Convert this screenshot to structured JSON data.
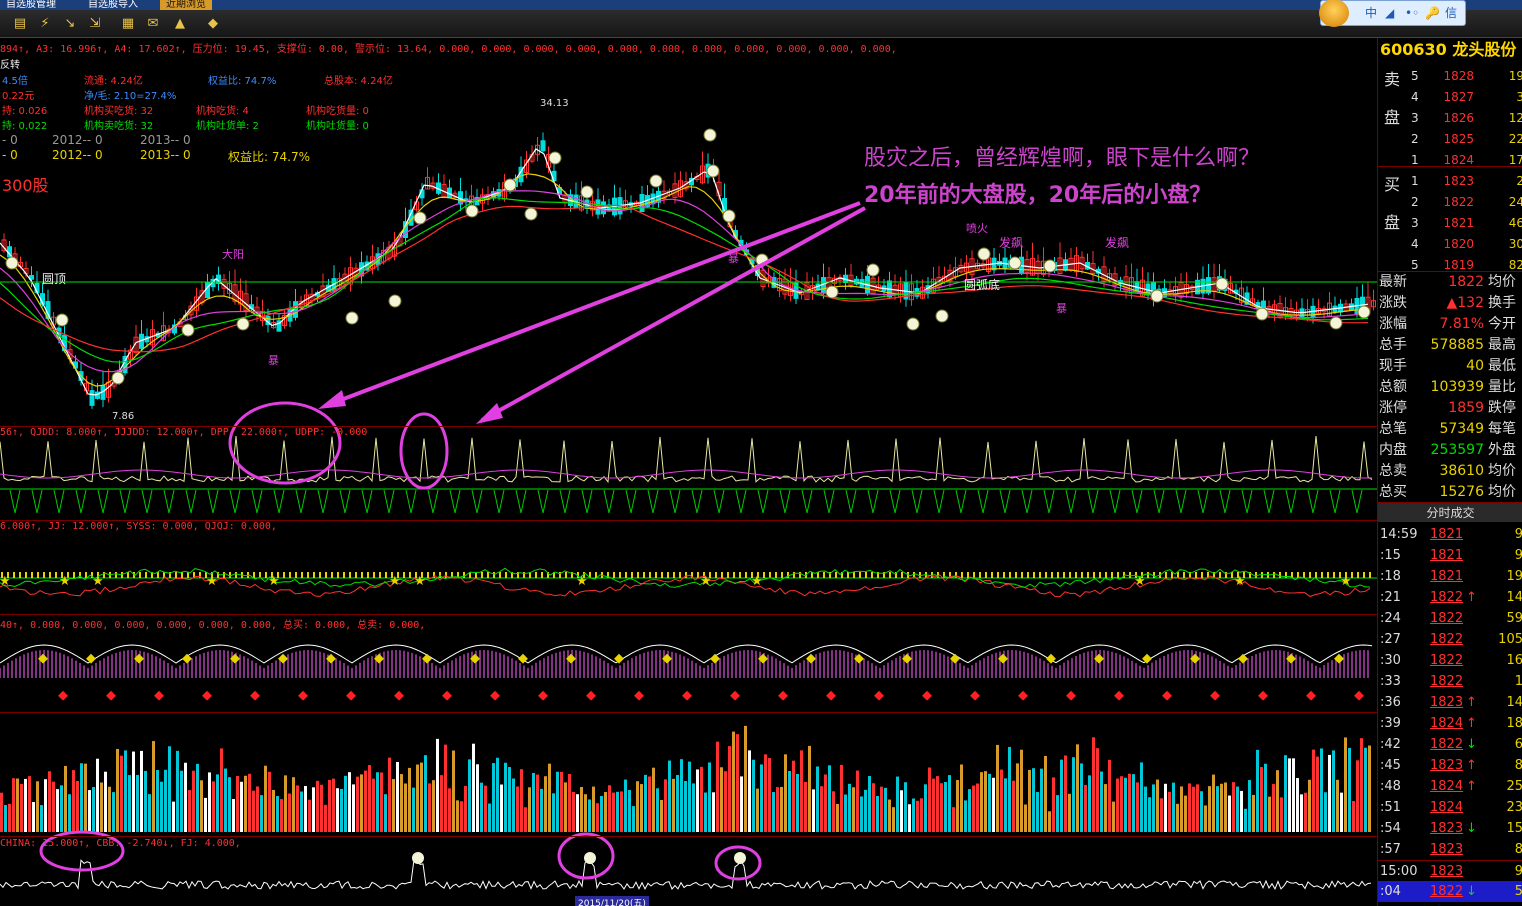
{
  "tabs": [
    "自选股管理",
    "自选股导入",
    "近期浏览"
  ],
  "qq_bar": [
    "中",
    "◢",
    "•◦",
    "🔑",
    "信"
  ],
  "indicator_lines": {
    "main": "894↑, A3: 16.996↑, A4: 17.602↑, 压力位: 19.45, 支撑位: 0.00, 警示位: 13.64, 0.000, 0.000, 0.000, 0.000, 0.000, 0.000, 0.000, 0.000, 0.000, 0.000, 0.000,",
    "fundamentals": [
      [
        "反转"
      ],
      [
        "4.5倍",
        "流通: 4.24亿",
        "权益比: 74.7%",
        "总股本: 4.24亿"
      ],
      [
        "0.22元",
        "净/毛: 2.10=27.4%"
      ],
      [
        "持: 0.026",
        "机构买吃货: 32",
        "机构吃货: 4",
        "机构吃货量: 0"
      ],
      [
        "持: 0.022",
        "机构卖吃货: 32",
        "机构吐货单: 2",
        "机构吐货量: 0"
      ],
      [
        "- 0",
        "2012-- 0",
        "2013-- 0"
      ],
      [
        "- 0",
        "2012-- 0",
        "2013-- 0",
        "权益比: 74.7%"
      ],
      [
        "300股"
      ]
    ],
    "sub1": "56↑, QJDD: 8.000↑, JJJDD: 12.000↑, DPP: 22.000↑, UDPP: -0.000",
    "sub2": "6.000↑, JJ: 12.000↑, SYSS: 0.000, QJQJ: 0.000,",
    "sub3": "40↑, 0.000, 0.000, 0.000, 0.000, 0.000, 0.000, 总买: 0.000, 总卖: 0.000,",
    "sub5": "CHINA: 15.000↑, CBB: -2.740↓, FJ: 4.000,"
  },
  "chart_labels": {
    "price_high": "34.13",
    "price_low": "7.86",
    "signals": [
      "圆顶",
      "圆弧底",
      "发飙",
      "发飙",
      "暴",
      "暴",
      "暴",
      "喷火",
      "大阳"
    ],
    "bottom_date": "2015/11/20(五)"
  },
  "annotation": {
    "line1": "股灾之后，曾经辉煌啊，眼下是什么啊？",
    "line2": "20年前的大盘股，20年后的小盘？"
  },
  "quote_panel": {
    "code": "600630",
    "name": "龙头股份",
    "sell_label": [
      "卖",
      "盘"
    ],
    "buy_label": [
      "买",
      "盘"
    ],
    "asks": [
      {
        "lv": "5",
        "price": "1828",
        "vol": "19"
      },
      {
        "lv": "4",
        "price": "1827",
        "vol": "3"
      },
      {
        "lv": "3",
        "price": "1826",
        "vol": "12"
      },
      {
        "lv": "2",
        "price": "1825",
        "vol": "22"
      },
      {
        "lv": "1",
        "price": "1824",
        "vol": "17"
      }
    ],
    "bids": [
      {
        "lv": "1",
        "price": "1823",
        "vol": "2"
      },
      {
        "lv": "2",
        "price": "1822",
        "vol": "24"
      },
      {
        "lv": "3",
        "price": "1821",
        "vol": "46"
      },
      {
        "lv": "4",
        "price": "1820",
        "vol": "30"
      },
      {
        "lv": "5",
        "price": "1819",
        "vol": "82"
      }
    ],
    "stats": [
      {
        "k": "最新",
        "v": "1822",
        "k2": "均价",
        "c": "red"
      },
      {
        "k": "涨跌",
        "v": "▲132",
        "k2": "换手",
        "c": "red"
      },
      {
        "k": "涨幅",
        "v": "7.81%",
        "k2": "今开",
        "c": "red"
      },
      {
        "k": "总手",
        "v": "578885",
        "k2": "最高",
        "c": "yel"
      },
      {
        "k": "现手",
        "v": "40",
        "k2": "最低",
        "c": "yel"
      },
      {
        "k": "总额",
        "v": "103939",
        "k2": "量比",
        "c": "yel"
      },
      {
        "k": "涨停",
        "v": "1859",
        "k2": "跌停",
        "c": "red"
      },
      {
        "k": "总笔",
        "v": "57349",
        "k2": "每笔",
        "c": "yel"
      },
      {
        "k": "内盘",
        "v": "253597",
        "k2": "外盘",
        "c": "grn"
      },
      {
        "k": "总卖",
        "v": "38610",
        "k2": "均价",
        "c": "yel"
      },
      {
        "k": "总买",
        "v": "15276",
        "k2": "均价",
        "c": "yel"
      }
    ],
    "ticks_title": "分时成交",
    "ticks": [
      {
        "t": "14:59",
        "p": "1821",
        "a": "",
        "v": "9"
      },
      {
        "t": ":15",
        "p": "1821",
        "a": "",
        "v": "9"
      },
      {
        "t": ":18",
        "p": "1821",
        "a": "",
        "v": "19"
      },
      {
        "t": ":21",
        "p": "1822",
        "a": "↑",
        "v": "14"
      },
      {
        "t": ":24",
        "p": "1822",
        "a": "",
        "v": "59"
      },
      {
        "t": ":27",
        "p": "1822",
        "a": "",
        "v": "105"
      },
      {
        "t": ":30",
        "p": "1822",
        "a": "",
        "v": "16"
      },
      {
        "t": ":33",
        "p": "1822",
        "a": "",
        "v": "1"
      },
      {
        "t": ":36",
        "p": "1823",
        "a": "↑",
        "v": "14"
      },
      {
        "t": ":39",
        "p": "1824",
        "a": "↑",
        "v": "18"
      },
      {
        "t": ":42",
        "p": "1822",
        "a": "↓",
        "v": "6"
      },
      {
        "t": ":45",
        "p": "1823",
        "a": "↑",
        "v": "8"
      },
      {
        "t": ":48",
        "p": "1824",
        "a": "↑",
        "v": "25"
      },
      {
        "t": ":51",
        "p": "1824",
        "a": "",
        "v": "23"
      },
      {
        "t": ":54",
        "p": "1823",
        "a": "↓",
        "v": "15"
      },
      {
        "t": ":57",
        "p": "1823",
        "a": "",
        "v": "8"
      },
      {
        "t": "15:00",
        "p": "1823",
        "a": "",
        "v": "9"
      },
      {
        "t": ":04",
        "p": "1822",
        "a": "↓",
        "v": "5"
      }
    ]
  }
}
